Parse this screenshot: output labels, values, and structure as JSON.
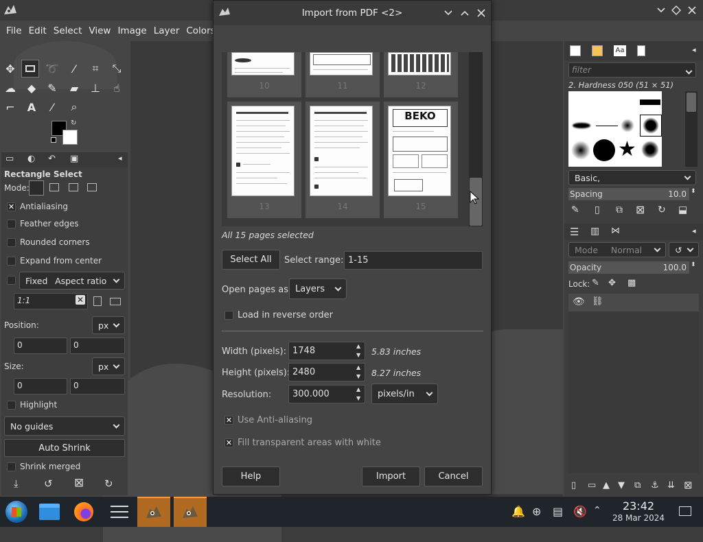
{
  "main_menu": [
    "File",
    "Edit",
    "Select",
    "View",
    "Image",
    "Layer",
    "Colors"
  ],
  "toolbox": {
    "tools": [
      "move-tool-icon",
      "rect-select-tool-icon",
      "free-select-tool-icon",
      "fuzzy-select-tool-icon",
      "crop-tool-icon",
      "unified-transform-tool-icon",
      "warp-tool-icon",
      "bucket-fill-tool-icon",
      "paintbrush-tool-icon",
      "eraser-tool-icon",
      "clone-tool-icon",
      "smudge-tool-icon",
      "paths-tool-icon",
      "text-tool-icon",
      "color-picker-tool-icon",
      "zoom-tool-icon"
    ],
    "fg_color": "#000000",
    "bg_color": "#ffffff"
  },
  "tool_options": {
    "title": "Rectangle Select",
    "mode_label": "Mode:",
    "antialiasing": "Antialiasing",
    "feather_edges": "Feather edges",
    "rounded_corners": "Rounded corners",
    "expand_from_center": "Expand from center",
    "fixed": "Fixed",
    "aspect_ratio": "Aspect ratio",
    "ratio_value": "1:1",
    "position_label": "Position:",
    "position_unit": "px",
    "position_x": "0",
    "position_y": "0",
    "size_label": "Size:",
    "size_unit": "px",
    "size_w": "0",
    "size_h": "0",
    "highlight": "Highlight",
    "guides": "No guides",
    "auto_shrink": "Auto Shrink",
    "shrink_merged": "Shrink merged"
  },
  "right_dock": {
    "filter_placeholder": "filter",
    "brush_name": "2. Hardness 050 (51 × 51)",
    "preset": "Basic,",
    "spacing_label": "Spacing",
    "spacing_value": "10.0",
    "mode_label": "Mode",
    "mode_value": "Normal",
    "opacity_label": "Opacity",
    "opacity_value": "100.0",
    "lock_label": "Lock:"
  },
  "dialog": {
    "title": "Import from PDF <2>",
    "pages": [
      {
        "num": "10",
        "kind": "text"
      },
      {
        "num": "11",
        "kind": "table"
      },
      {
        "num": "12",
        "kind": "grid"
      },
      {
        "num": "13",
        "kind": "text"
      },
      {
        "num": "14",
        "kind": "text"
      },
      {
        "num": "15",
        "kind": "beko"
      }
    ],
    "beko_logo": "BEKO",
    "selected_text": "All 15 pages selected",
    "select_all": "Select All",
    "select_range_label": "Select range:",
    "select_range_value": "1-15",
    "open_pages_label": "Open pages as",
    "open_pages_value": "Layers",
    "reverse_order": "Load in reverse order",
    "width_label": "Width (pixels):",
    "width_value": "1748",
    "width_inches": "5.83 inches",
    "height_label": "Height (pixels):",
    "height_value": "2480",
    "height_inches": "8.27 inches",
    "resolution_label": "Resolution:",
    "resolution_value": "300.000",
    "resolution_unit": "pixels/in",
    "anti_aliasing": "Use Anti-aliasing",
    "fill_transparent": "Fill transparent areas with white",
    "help": "Help",
    "import": "Import",
    "cancel": "Cancel"
  },
  "taskbar": {
    "time": "23:42",
    "date": "28 Mar 2024"
  }
}
